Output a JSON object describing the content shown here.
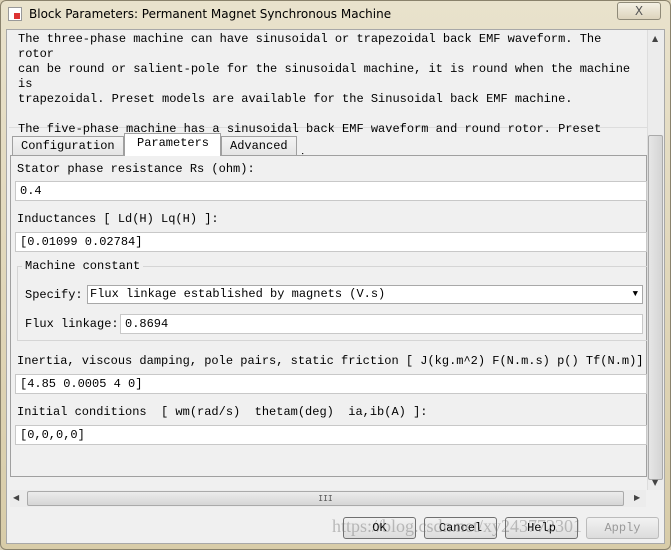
{
  "window": {
    "title": "Block Parameters: Permanent Magnet Synchronous Machine",
    "close": "X"
  },
  "description": "The three-phase machine can have sinusoidal or trapezoidal back EMF waveform. The rotor\ncan be round or salient-pole for the sinusoidal machine, it is round when the machine is\ntrapezoidal. Preset models are available for the Sinusoidal back EMF machine.\n\nThe five-phase machine has a sinusoidal back EMF waveform and round rotor. Preset models\nare not available for this type of machine.",
  "tabs": [
    {
      "label": "Configuration"
    },
    {
      "label": "Parameters",
      "active": true
    },
    {
      "label": "Advanced"
    }
  ],
  "params": {
    "stator_label": "Stator phase resistance Rs (ohm):",
    "stator_value": "0.4",
    "ind_label": "Inductances [ Ld(H) Lq(H) ]:",
    "ind_value": "[0.01099 0.02784]",
    "machine_constant": "Machine constant",
    "specify_label": "Specify:",
    "specify_value": "Flux linkage established by magnets (V.s)",
    "flux_label": "Flux linkage:",
    "flux_value": "0.8694",
    "inertia_label": "Inertia, viscous damping, pole pairs, static friction [ J(kg.m^2)  F(N.m.s)  p()  Tf(N.m)]",
    "inertia_value": "[4.85 0.0005 4 0]",
    "init_label": "Initial conditions  [ wm(rad/s)  thetam(deg)  ia,ib(A) ]:",
    "init_value": "[0,0,0,0]"
  },
  "scroll": {
    "grip": "III"
  },
  "buttons": {
    "ok": "OK",
    "cancel": "Cancel",
    "help": "Help",
    "apply": "Apply"
  },
  "watermark": "https://blog.csdn.net/xy243772301"
}
